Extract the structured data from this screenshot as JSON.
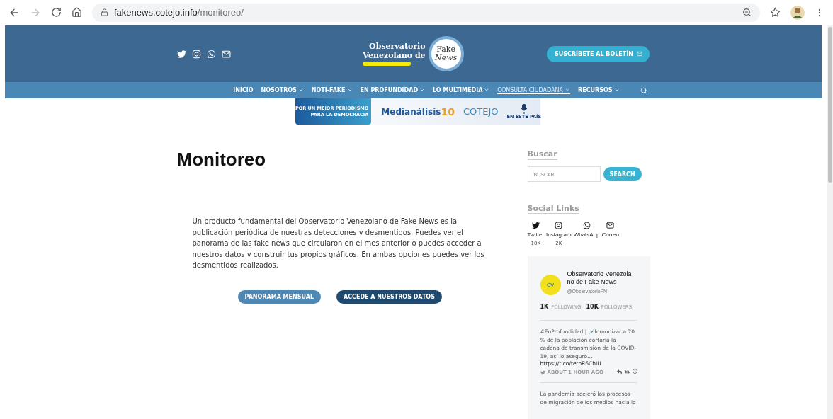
{
  "browser": {
    "url_host": "fakenews.cotejo.info",
    "url_path": "/monitoreo/",
    "forward_disabled": true
  },
  "header": {
    "social": [
      {
        "kind": "twitter"
      },
      {
        "kind": "instagram"
      },
      {
        "kind": "whatsapp"
      },
      {
        "kind": "mail"
      }
    ],
    "logo": {
      "line_1": "Observatorio",
      "line_2": "Venezolano de",
      "badge_1": "Fake",
      "badge_2": "News"
    },
    "subscribe_button": "SUSCRÍBETE AL BOLETÍN"
  },
  "nav": [
    {
      "label": "INICIO",
      "has_menu": false,
      "selected": false
    },
    {
      "label": "NOSOTROS",
      "has_menu": true,
      "selected": false
    },
    {
      "label": "NOTI-FAKE",
      "has_menu": true,
      "selected": false
    },
    {
      "label": "EN PROFUNDIDAD",
      "has_menu": true,
      "selected": false
    },
    {
      "label": "LO MULTIMEDIA",
      "has_menu": true,
      "selected": false
    },
    {
      "label": "CONSULTA CIUDADANA",
      "has_menu": true,
      "selected": true
    },
    {
      "label": "RECURSOS",
      "has_menu": true,
      "selected": false
    }
  ],
  "banner": {
    "slogan_1": "POR UN MEJOR PERIODISMO",
    "slogan_2": "PARA LA DEMOCRACIA",
    "logo_1": "Medianálisis",
    "logo_1_badge": "10",
    "logo_2": "COTEJO",
    "logo_3": "EN ESTE PAÍS"
  },
  "main": {
    "title": "Monitoreo",
    "body": "Un producto fundamental del Observatorio Venezolano de Fake News es la publicación periódica de nuestras detecciones y desmentidos.   Puedes ver el panorama de las fake news que circularon en el mes anterior o  puedes acceder a nuestros datos y construir tus propios gráficos. En ambas opciones puedes ver los desmentidos realizados.",
    "buttons": [
      {
        "label": "PANORAMA MENSUAL",
        "kind": "light"
      },
      {
        "label": "ACCEDE A NUESTROS DATOS",
        "kind": "dark"
      }
    ]
  },
  "sidebar": {
    "search_heading": "Buscar",
    "search_placeholder": "BUSCAR",
    "search_button": "SEARCH",
    "social_heading": "Social Links",
    "social_links": [
      {
        "kind": "twitter",
        "label": "Twitter",
        "count": "10K"
      },
      {
        "kind": "instagram",
        "label": "Instagram",
        "count": "2K"
      },
      {
        "kind": "whatsapp",
        "label": "WhatsApp"
      },
      {
        "kind": "mail",
        "label": "Correo"
      }
    ],
    "twitter_feed": {
      "avatar": "OV",
      "name": "Observatorio Venezola no de Fake News",
      "handle": "@ObservatorioFN",
      "following_count": "1K",
      "following_label": "FOLLOWING",
      "followers_count": "10K",
      "followers_label": "FOLLOWERS",
      "tweets": [
        {
          "text": "#EnProfundidad | 💉Inmunizar a 70 % de la población cortaría la cadena de transmisión de la COVID-19, así lo aseguró…",
          "link": "https://t.co/tetoR6ChIU",
          "time": "ABOUT 1 HOUR AGO"
        },
        {
          "text": "La pandemia aceleró los procesos de migración de los medios hacia lo"
        }
      ]
    }
  }
}
